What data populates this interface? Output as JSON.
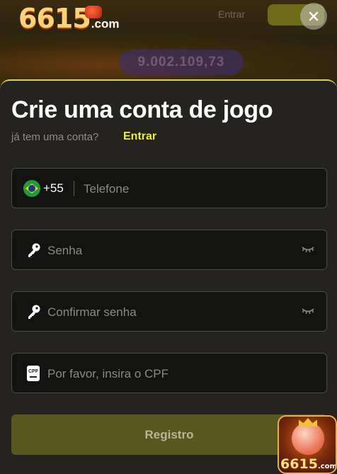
{
  "site": {
    "logo_number": "6615",
    "logo_suffix": ".com",
    "header_login_label": "Entrar",
    "jackpot_value": "9.002.109,73"
  },
  "modal": {
    "title": "Crie uma conta de jogo",
    "have_account_text": "já tem uma conta?",
    "login_link": "Entrar",
    "phone": {
      "country_code": "+55",
      "placeholder": "Telefone"
    },
    "password": {
      "placeholder": "Senha"
    },
    "confirm_password": {
      "placeholder": "Confirmar senha"
    },
    "cpf": {
      "icon_label": "CPF",
      "placeholder": "Por favor, insira o CPF"
    },
    "submit_label": "Registro"
  },
  "app_badge": {
    "logo_number": "6615",
    "logo_suffix": ".com"
  },
  "colors": {
    "accent": "#ecef2a",
    "modal_bg": "#242320",
    "field_bg": "#131312",
    "submit_bg": "#59561f"
  },
  "icons": {
    "close": "close-icon",
    "flag": "brazil-flag-icon",
    "key": "key-icon",
    "eye": "eye-closed-icon",
    "cpf": "cpf-card-icon"
  }
}
